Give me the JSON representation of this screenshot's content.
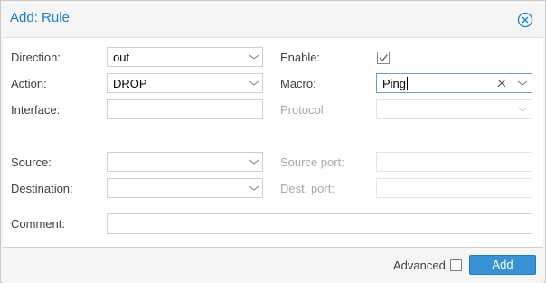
{
  "dialog": {
    "title": "Add: Rule",
    "close_icon": "close-circle-icon"
  },
  "form": {
    "direction": {
      "label": "Direction:",
      "value": "out"
    },
    "action": {
      "label": "Action:",
      "value": "DROP"
    },
    "interface": {
      "label": "Interface:",
      "value": ""
    },
    "enable": {
      "label": "Enable:",
      "checked": true
    },
    "macro": {
      "label": "Macro:",
      "value": "Ping"
    },
    "protocol": {
      "label": "Protocol:",
      "value": "",
      "disabled": true
    },
    "source": {
      "label": "Source:",
      "value": ""
    },
    "source_port": {
      "label": "Source port:",
      "value": "",
      "disabled": true
    },
    "destination": {
      "label": "Destination:",
      "value": ""
    },
    "dest_port": {
      "label": "Dest. port:",
      "value": "",
      "disabled": true
    },
    "comment": {
      "label": "Comment:",
      "value": ""
    }
  },
  "footer": {
    "advanced_label": "Advanced",
    "advanced_checked": false,
    "add_label": "Add"
  },
  "colors": {
    "accent": "#157fcc",
    "button_bg": "#3892d4"
  }
}
